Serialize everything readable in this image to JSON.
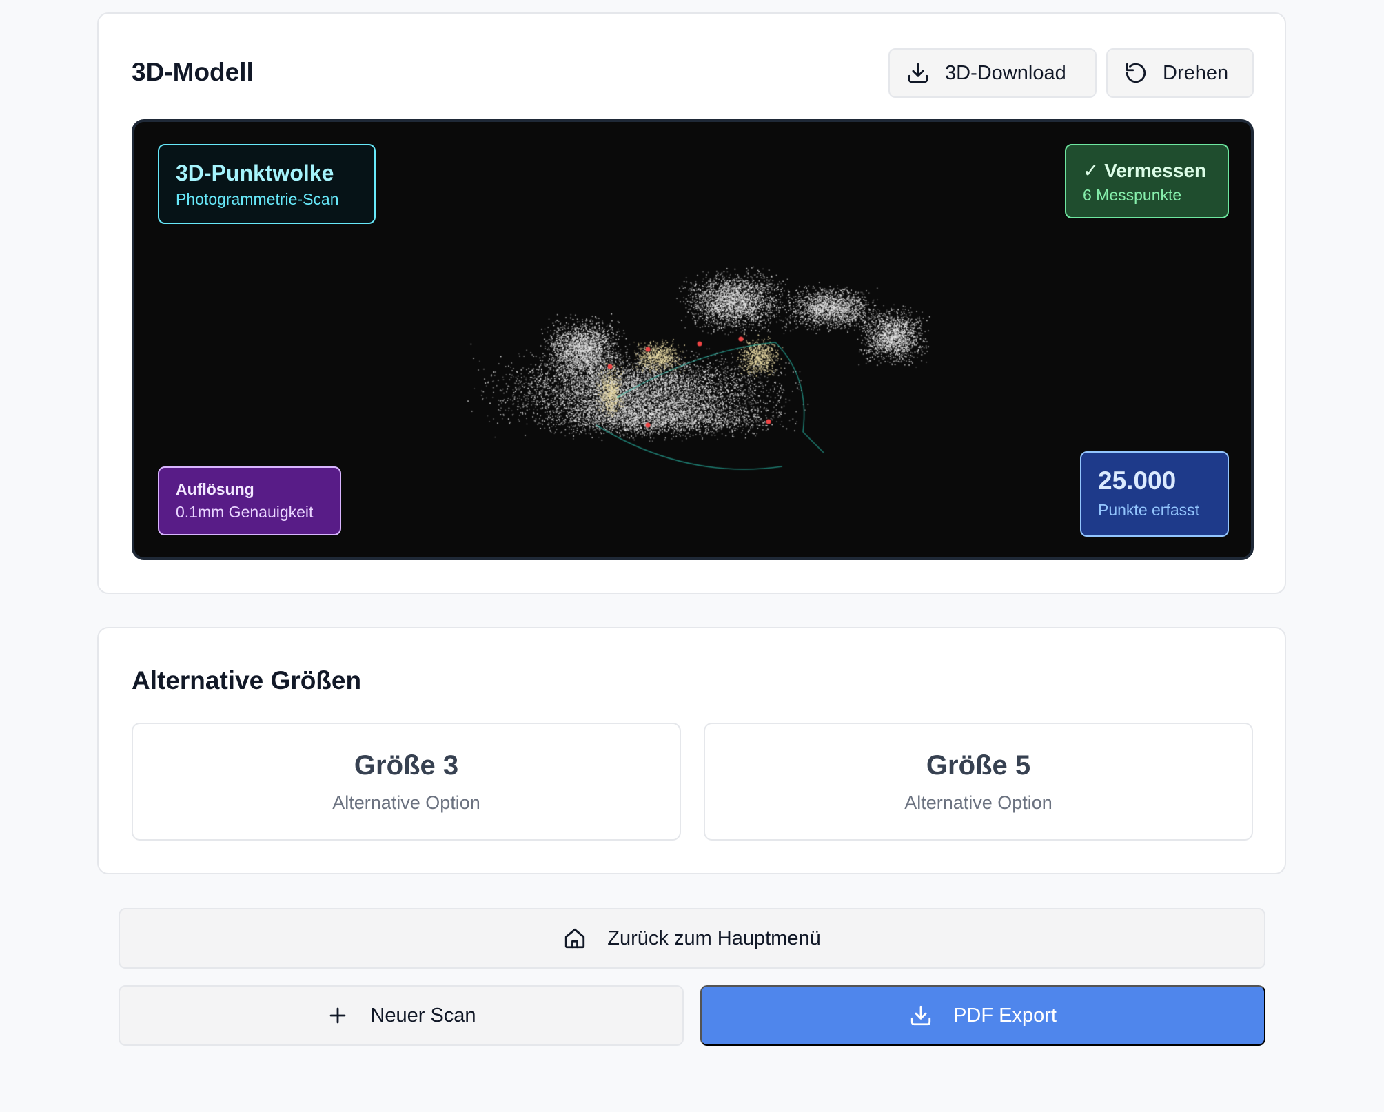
{
  "model": {
    "title": "3D-Modell",
    "download_label": "3D-Download",
    "rotate_label": "Drehen",
    "viewer": {
      "cloud_title": "3D-Punktwolke",
      "cloud_subtitle": "Photogrammetrie-Scan",
      "measure_title": "✓ Vermessen",
      "measure_subtitle": "6 Messpunkte",
      "measure_points": 6,
      "resolution_title": "Auflösung",
      "resolution_subtitle": "0.1mm Genauigkeit",
      "points_value": "25.000",
      "points_label": "Punkte erfasst"
    }
  },
  "sizes": {
    "title": "Alternative Größen",
    "options": [
      {
        "label": "Größe 3",
        "note": "Alternative Option"
      },
      {
        "label": "Größe 5",
        "note": "Alternative Option"
      }
    ]
  },
  "actions": {
    "home_label": "Zurück zum Hauptmenü",
    "new_scan_label": "Neuer Scan",
    "pdf_label": "PDF Export"
  },
  "colors": {
    "primary": "#4f86ec",
    "cloud_accent": "#67e8f9",
    "measure_accent": "#6ee7a0",
    "resolution_accent": "#d8b4fe",
    "points_accent": "#93c5fd"
  }
}
